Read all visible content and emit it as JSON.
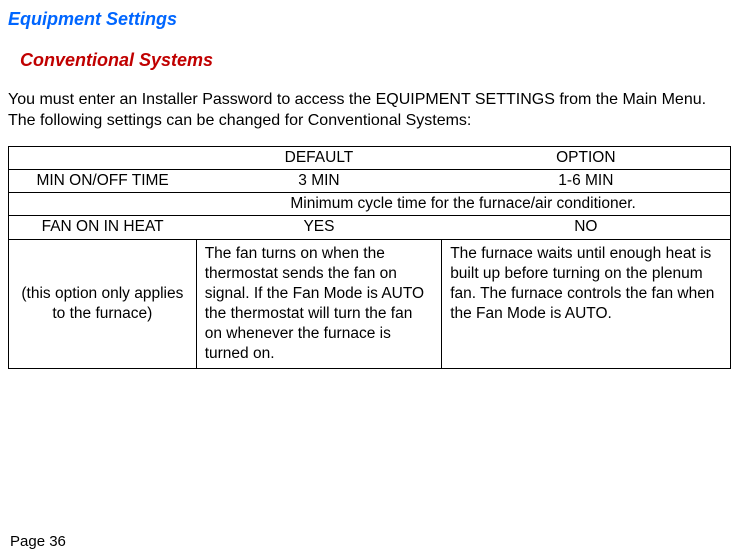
{
  "headings": {
    "main": "Equipment Settings",
    "sub": "Conventional Systems"
  },
  "intro": "You must enter an Installer Password to access the EQUIPMENT SETTINGS from the Main Menu. The following settings can be changed for Conventional Systems:",
  "table": {
    "header": {
      "col1": "",
      "default": "DEFAULT",
      "option": "OPTION"
    },
    "row_minonoff": {
      "label": "MIN ON/OFF TIME",
      "default": "3 MIN",
      "option": "1-6 MIN"
    },
    "row_mincycle_desc": "Minimum cycle time for the furnace/air conditioner.",
    "row_fanonheat": {
      "label": "FAN ON IN HEAT",
      "default": "YES",
      "option": "NO"
    },
    "row_fan_detail": {
      "note": "(this option only applies to the furnace)",
      "yes_desc": "The fan turns on when the thermostat sends the fan on signal.  If the Fan Mode is AUTO the thermostat will turn the fan on whenever the furnace is turned on.",
      "no_desc": "The furnace waits until enough heat is built up before turning on the plenum fan. The furnace controls the fan when the Fan Mode is AUTO."
    }
  },
  "page_number": "Page 36"
}
